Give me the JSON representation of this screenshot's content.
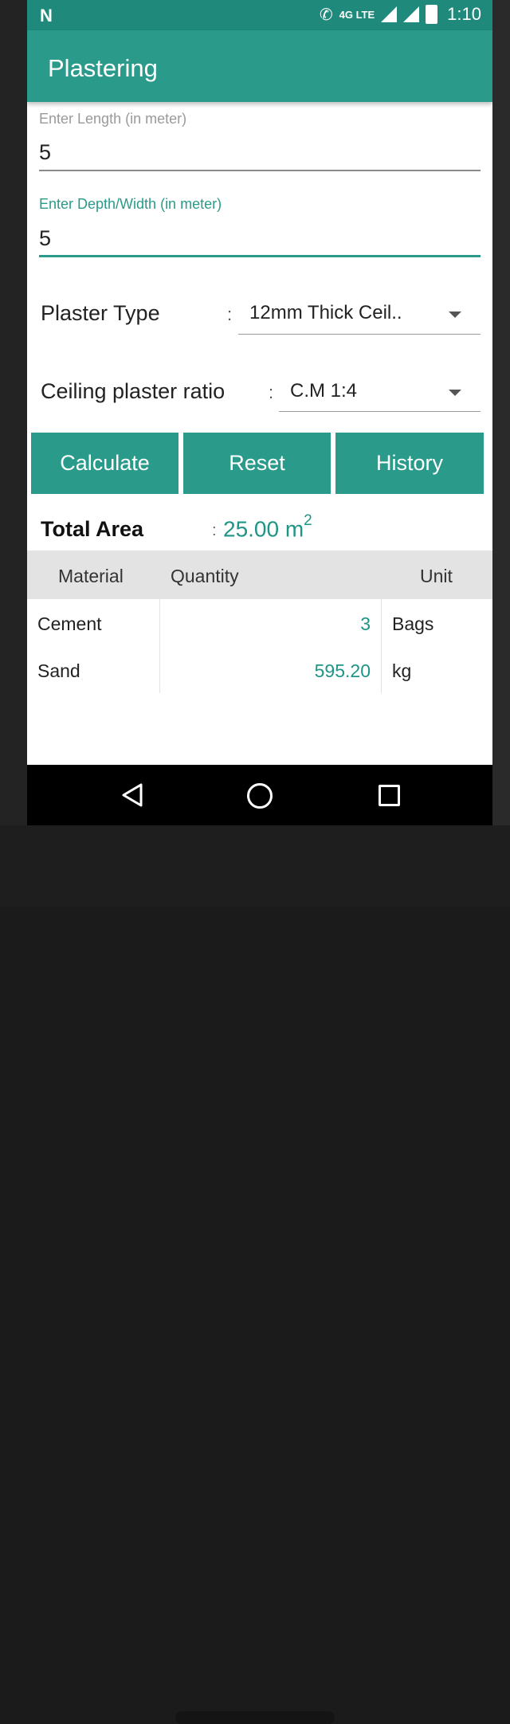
{
  "status_bar": {
    "logo": "N",
    "network_label": "4G LTE",
    "time": "1:10"
  },
  "app_bar": {
    "title": "Plastering"
  },
  "length_field": {
    "label": "Enter Length (in meter)",
    "value": "5"
  },
  "depth_field": {
    "label": "Enter Depth/Width (in meter)",
    "value": "5"
  },
  "plaster_type": {
    "label": "Plaster Type",
    "colon": ":",
    "selected": "12mm Thick Ceil.."
  },
  "ceiling_ratio": {
    "label": "Ceiling plaster ratio",
    "colon": ":",
    "selected": "C.M 1:4"
  },
  "buttons": {
    "calculate": "Calculate",
    "reset": "Reset",
    "history": "History"
  },
  "total_area": {
    "label": "Total Area",
    "colon": ":",
    "value": "25.00 m",
    "unit_exponent": "2"
  },
  "table": {
    "headers": {
      "material": "Material",
      "quantity": "Quantity",
      "unit": "Unit"
    },
    "rows": [
      {
        "material": "Cement",
        "quantity": "3",
        "unit": "Bags"
      },
      {
        "material": "Sand",
        "quantity": "595.20",
        "unit": "kg"
      }
    ]
  },
  "colors": {
    "primary": "#2a9a8a",
    "primary_dark": "#1f8a7c",
    "accent_text": "#1f9585"
  }
}
